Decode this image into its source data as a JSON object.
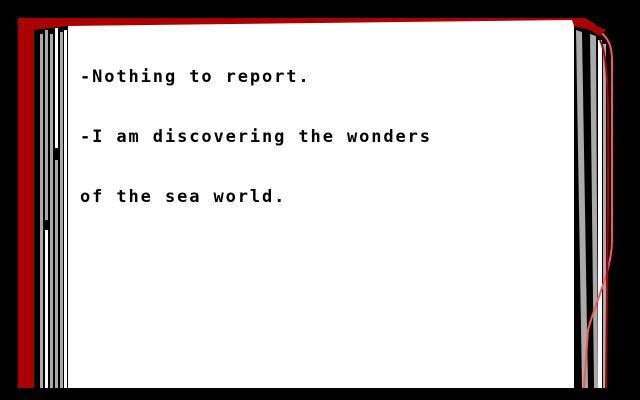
{
  "colors": {
    "background": "#000000",
    "page": "#ffffff",
    "binding_red": "#aa0000",
    "binding_grey": "#aaaaaa",
    "text": "#000000",
    "ribbon_red": "#ff5555"
  },
  "journal": {
    "lines": [
      "-Nothing to report.",
      "-I am discovering the wonders",
      "of the sea world."
    ]
  }
}
